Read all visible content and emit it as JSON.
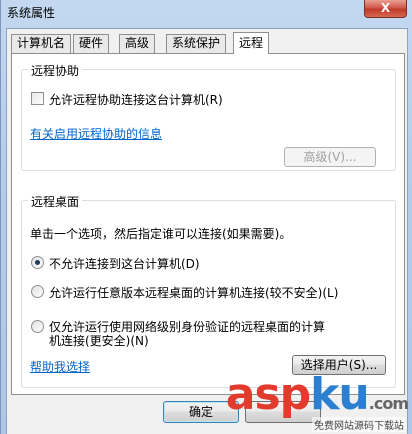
{
  "window": {
    "title": "系统属性",
    "close_label": "X"
  },
  "tabs": [
    {
      "label": "计算机名"
    },
    {
      "label": "硬件"
    },
    {
      "label": "高级"
    },
    {
      "label": "系统保护"
    },
    {
      "label": "远程"
    }
  ],
  "remote_assistance": {
    "group_label": "远程协助",
    "allow_checkbox_label": "允许远程协助连接这台计算机(R)",
    "allow_checked": false,
    "info_link": "有关启用远程协助的信息",
    "advanced_button": "高级(V)..."
  },
  "remote_desktop": {
    "group_label": "远程桌面",
    "instruction": "单击一个选项，然后指定谁可以连接(如果需要)。",
    "options": [
      {
        "label": "不允许连接到这台计算机(D)",
        "checked": true
      },
      {
        "label": "允许运行任意版本远程桌面的计算机连接(较不安全)(L)",
        "checked": false
      },
      {
        "label_line1": "仅允许运行使用网络级别身份验证的远程桌面的计算",
        "label_line2": "机连接(更安全)(N)",
        "checked": false
      }
    ],
    "help_link": "帮助我选择",
    "select_users_button": "选择用户(S)..."
  },
  "footer": {
    "ok_button": "确定"
  },
  "watermark": {
    "text_a": "asp",
    "text_b": "ku",
    "domain": ".com",
    "subtitle": "免费网站源码下载站"
  }
}
